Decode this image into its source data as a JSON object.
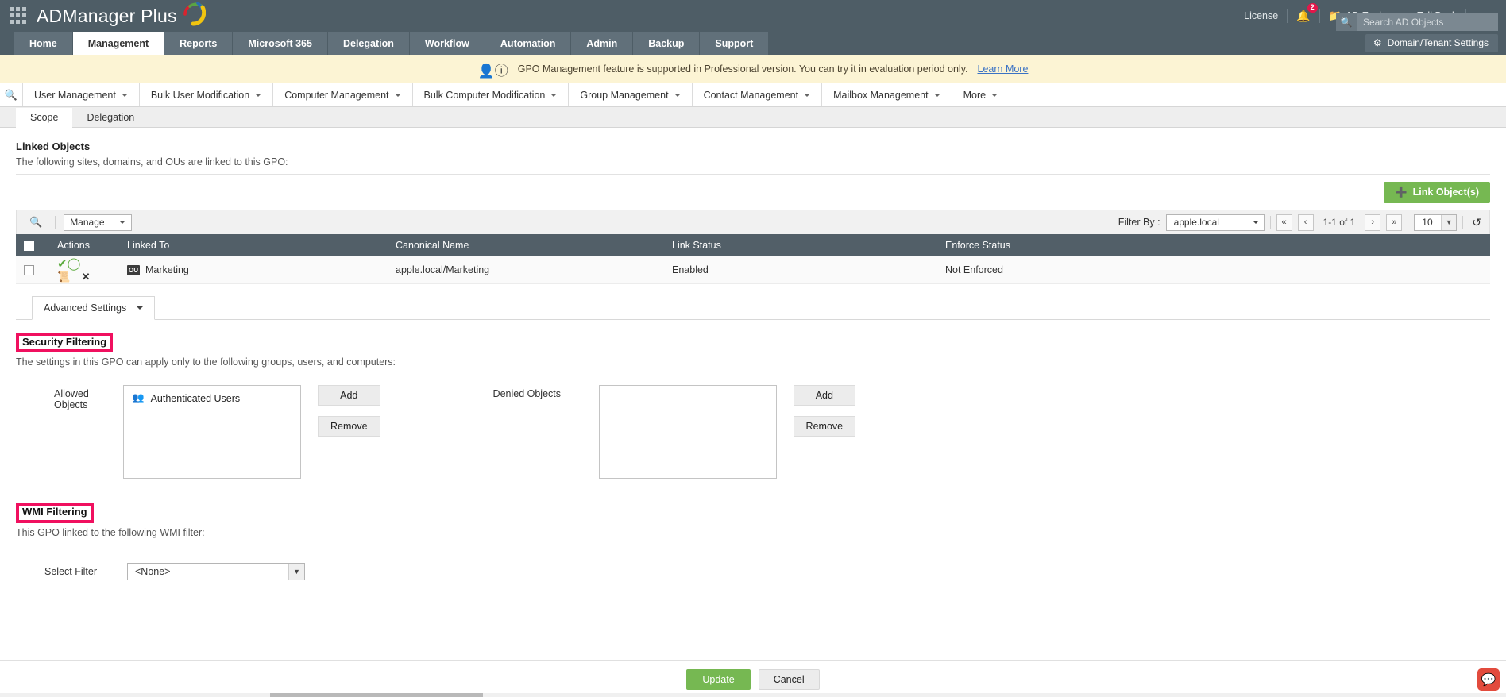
{
  "header": {
    "app_title": "ADManager Plus",
    "waffle_icon": "app-grid-icon",
    "license_label": "License",
    "notification_count": "2",
    "ad_explorer_label": "AD Explorer",
    "talkback_label": "TalkBack",
    "search_placeholder": "Search AD Objects",
    "search_value": "",
    "domain_tenant_settings_label": "Domain/Tenant Settings"
  },
  "nav": {
    "tabs": [
      {
        "label": "Home",
        "active": false
      },
      {
        "label": "Management",
        "active": true
      },
      {
        "label": "Reports",
        "active": false
      },
      {
        "label": "Microsoft 365",
        "active": false
      },
      {
        "label": "Delegation",
        "active": false
      },
      {
        "label": "Workflow",
        "active": false
      },
      {
        "label": "Automation",
        "active": false
      },
      {
        "label": "Admin",
        "active": false
      },
      {
        "label": "Backup",
        "active": false
      },
      {
        "label": "Support",
        "active": false
      }
    ]
  },
  "banner": {
    "text": "GPO Management feature is supported in Professional version. You can try it in evaluation period only.",
    "link_label": "Learn More"
  },
  "submenu": {
    "items": [
      {
        "label": "User Management"
      },
      {
        "label": "Bulk User Modification"
      },
      {
        "label": "Computer Management"
      },
      {
        "label": "Bulk Computer Modification"
      },
      {
        "label": "Group Management"
      },
      {
        "label": "Contact Management"
      },
      {
        "label": "Mailbox Management"
      },
      {
        "label": "More"
      }
    ]
  },
  "page_tabs": [
    {
      "label": "Scope",
      "active": true
    },
    {
      "label": "Delegation",
      "active": false
    }
  ],
  "linked_objects": {
    "title": "Linked Objects",
    "subtitle": "The following sites, domains, and OUs are linked to this GPO:",
    "link_button_label": "Link Object(s)",
    "toolbar": {
      "manage_label": "Manage",
      "filter_by_label": "Filter By :",
      "filter_value": "apple.local",
      "page_info": "1-1 of 1",
      "rows_per_page": "10",
      "first_label": "«",
      "prev_label": "‹",
      "next_label": "›",
      "last_label": "»"
    },
    "columns": [
      "Actions",
      "Linked To",
      "Canonical Name",
      "Link Status",
      "Enforce Status"
    ],
    "rows": [
      {
        "linked_to": "Marketing",
        "object_type": "OU",
        "canonical_name": "apple.local/Marketing",
        "link_status": "Enabled",
        "enforce_status": "Not Enforced"
      }
    ]
  },
  "advanced_settings": {
    "tab_label": "Advanced Settings"
  },
  "security_filtering": {
    "heading": "Security Filtering",
    "highlighted": true,
    "description": "The settings in this GPO can apply only to the following groups, users, and computers:",
    "allowed_label": "Allowed Objects",
    "allowed_items": [
      "Authenticated Users"
    ],
    "denied_label": "Denied Objects",
    "denied_items": [],
    "add_label": "Add",
    "remove_label": "Remove"
  },
  "wmi_filtering": {
    "heading": "WMI Filtering",
    "highlighted": true,
    "description": "This GPO linked to the following WMI filter:",
    "select_filter_label": "Select Filter",
    "selected_filter": "<None>"
  },
  "footer": {
    "update_label": "Update",
    "cancel_label": "Cancel"
  },
  "colors": {
    "header_bg": "#4e5d66",
    "nav_tab_bg": "#61707a",
    "accent_green": "#76b852",
    "highlight_pink": "#f0105f",
    "banner_bg": "#fcf4d4",
    "table_header_bg": "#525f68",
    "badge_red": "#e3174a"
  }
}
